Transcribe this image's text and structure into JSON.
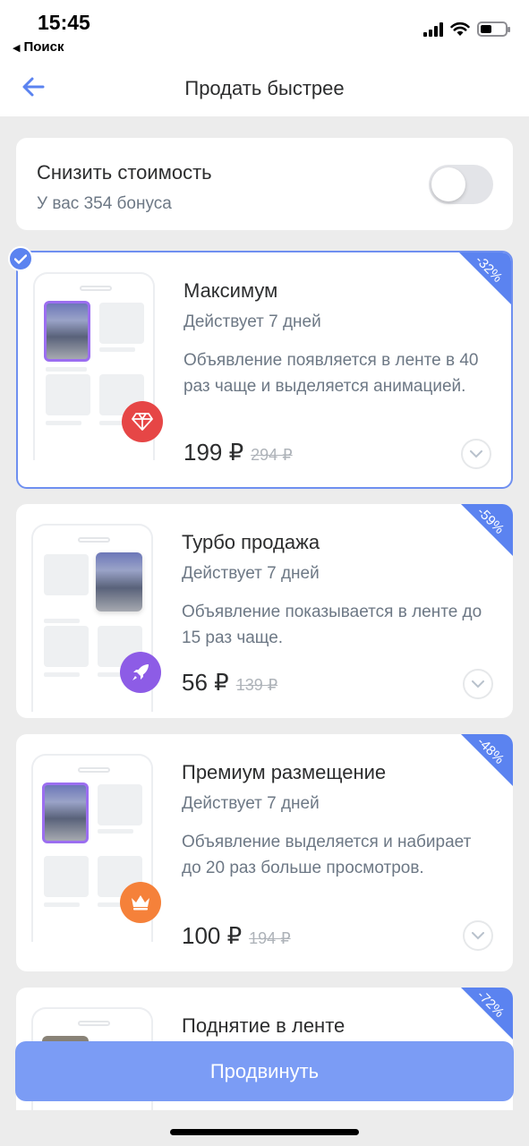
{
  "status_bar": {
    "time": "15:45",
    "back_label": "Поиск",
    "back_icon": "triangle-left-icon"
  },
  "nav": {
    "title": "Продать быстрее",
    "back_icon": "arrow-left-icon",
    "accent": "#5b83f0"
  },
  "price_toggle": {
    "title": "Снизить стоимость",
    "subtitle": "У вас 354 бонуса",
    "enabled": false
  },
  "services": [
    {
      "title": "Максимум",
      "duration": "Действует 7 дней",
      "description": "Объявление появляется в ленте в 40 раз чаще и выделяется анимацией.",
      "price": "199 ₽",
      "old_price": "294 ₽",
      "discount": "-32%",
      "icon": "diamond-icon",
      "icon_color": "#e64646",
      "selected": true
    },
    {
      "title": "Турбо продажа",
      "duration": "Действует 7 дней",
      "description": "Объявление показывается в ленте до 15 раз чаще.",
      "price": "56 ₽",
      "old_price": "139 ₽",
      "discount": "-59%",
      "icon": "rocket-icon",
      "icon_color": "#8d5ce6",
      "selected": false
    },
    {
      "title": "Премиум размещение",
      "duration": "Действует 7 дней",
      "description": "Объявление выделяется и набирает до 20 раз больше просмотров.",
      "price": "100 ₽",
      "old_price": "194 ₽",
      "discount": "-48%",
      "icon": "crown-icon",
      "icon_color": "#f5813a",
      "selected": false
    },
    {
      "title": "Поднятие в ленте",
      "discount": "-72%",
      "selected": false
    }
  ],
  "cta": {
    "label": "Продвинуть",
    "color": "#7b9cf5"
  }
}
